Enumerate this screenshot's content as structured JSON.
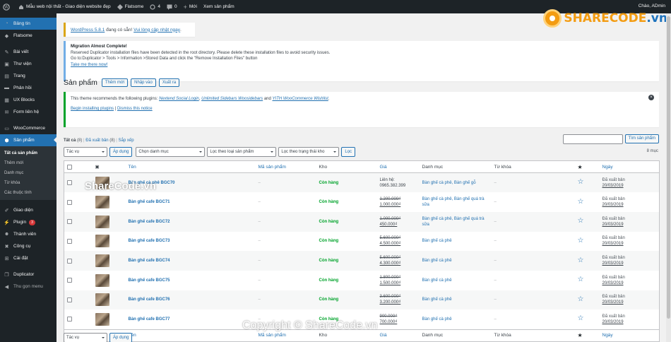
{
  "adminbar": {
    "site_name": "Mẫu web nội thất - Giao diện website đẹp",
    "theme": "Flatsome",
    "updates": "4",
    "comments": "0",
    "new_label": "Mới",
    "view_label": "Xem sản phẩm",
    "greeting": "Chào, ADmin"
  },
  "sidebar": {
    "items": [
      {
        "icon": "dashboard-icon",
        "label": "Bảng tin"
      },
      {
        "icon": "flatsome-icon",
        "label": "Flatsome"
      },
      {
        "icon": "pin-icon",
        "label": "Bài viết"
      },
      {
        "icon": "media-icon",
        "label": "Thư viện"
      },
      {
        "icon": "page-icon",
        "label": "Trang"
      },
      {
        "icon": "comment-icon",
        "label": "Phản hồi"
      },
      {
        "icon": "blocks-icon",
        "label": "UX Blocks"
      },
      {
        "icon": "form-icon",
        "label": "Form liên hệ"
      },
      {
        "icon": "woo-icon",
        "label": "WooCommerce"
      },
      {
        "icon": "product-icon",
        "label": "Sản phẩm"
      },
      {
        "icon": "brush-icon",
        "label": "Giao diện"
      },
      {
        "icon": "plugin-icon",
        "label": "Plugin",
        "badge": "3"
      },
      {
        "icon": "user-icon",
        "label": "Thành viên"
      },
      {
        "icon": "tool-icon",
        "label": "Công cụ"
      },
      {
        "icon": "settings-icon",
        "label": "Cài đặt"
      },
      {
        "icon": "duplicator-icon",
        "label": "Duplicator"
      },
      {
        "icon": "collapse-icon",
        "label": "Thu gọn menu"
      }
    ],
    "submenu": [
      "Tất cả sản phẩm",
      "Thêm mới",
      "Danh mục",
      "Từ khóa",
      "Các thuộc tính"
    ]
  },
  "notices": {
    "update_link": "WordPress 5.8.1",
    "update_text": " đang có sẵn! ",
    "update_action": "Vui lòng cập nhật ngay",
    "update_end": ".",
    "migration_title": "Migration Almost Complete!",
    "migration_line1": "Reserved Duplicator installation files have been detected in the root directory. Please delete these installation files to avoid security issues.",
    "migration_line2": "Go to:Duplicator > Tools > Information >Stored Data and click the \"Remove Installation Files\" button",
    "migration_link": "Take me there now!",
    "plugin_text1": "This theme recommends the following plugins: ",
    "plugin_a": "Nextend Social Login",
    "plugin_sep1": ", ",
    "plugin_b": "Unlimited Sidebars Woosidebars",
    "plugin_sep2": " and ",
    "plugin_c": "YITH WooCommerce Wishlist",
    "plugin_end": ".",
    "begin_link": "Begin installing plugins",
    "dismiss_link": "Dismiss this notice"
  },
  "page": {
    "title": "Sản phẩm",
    "add_new": "Thêm mới",
    "import": "Nhập vào",
    "export": "Xuất ra"
  },
  "views": {
    "all": "Tất cả",
    "all_count": "(8)",
    "published": "Đã xuất bản",
    "published_count": "(8)",
    "sort": "Sắp xếp"
  },
  "search": {
    "button": "Tìm sản phẩm"
  },
  "filters": {
    "bulk": "Tác vụ",
    "apply": "Áp dụng",
    "category": "Chọn danh mục",
    "type": "Lọc theo loại sản phẩm",
    "stock": "Lọc theo trạng thái kho",
    "filter": "Lọc",
    "count": "8 mục"
  },
  "table": {
    "headers": {
      "name": "Tên",
      "sku": "Mã sản phẩm",
      "stock": "Kho",
      "price": "Giá",
      "categories": "Danh mục",
      "tags": "Từ khóa",
      "date": "Ngày"
    },
    "rows": [
      {
        "name": "Bàn ghế cà phê BGC70",
        "sku": "–",
        "stock": "Còn hàng",
        "price_old": "Liên hệ:",
        "price_new": "0965.382.399",
        "price_contact": true,
        "categories": "Bàn ghế cà phê, Bàn ghế gỗ",
        "tags": "–",
        "status": "Đã xuất bản",
        "date": "20/03/2019"
      },
      {
        "name": "Bàn ghế cafe BGC71",
        "sku": "–",
        "stock": "Còn hàng",
        "price_old": "1.200.000₫",
        "price_new": "1.000.000₫",
        "categories": "Bàn ghế cà phê, Bàn ghế quá trà sữa",
        "tags": "–",
        "status": "Đã xuất bản",
        "date": "20/03/2019"
      },
      {
        "name": "Bàn ghế cafe BGC72",
        "sku": "–",
        "stock": "Còn hàng",
        "price_old": "1.000.000₫",
        "price_new": "450.000₫",
        "categories": "Bàn ghế cà phê, Bàn ghế quá trà sữa",
        "tags": "–",
        "status": "Đã xuất bản",
        "date": "20/03/2019"
      },
      {
        "name": "Bàn ghế cafe BGC73",
        "sku": "–",
        "stock": "Còn hàng",
        "price_old": "5.600.000₫",
        "price_new": "4.500.000₫",
        "categories": "Bàn ghế cà phê",
        "tags": "–",
        "status": "Đã xuất bản",
        "date": "20/03/2019"
      },
      {
        "name": "Bàn ghế cafe BGC74",
        "sku": "–",
        "stock": "Còn hàng",
        "price_old": "5.600.000₫",
        "price_new": "4.300.000₫",
        "categories": "Bàn ghế cà phê",
        "tags": "–",
        "status": "Đã xuất bản",
        "date": "20/03/2019"
      },
      {
        "name": "Bàn ghế cafe BGC75",
        "sku": "–",
        "stock": "Còn hàng",
        "price_old": "1.800.000₫",
        "price_new": "1.500.000₫",
        "categories": "Bàn ghế cà phê",
        "tags": "–",
        "status": "Đã xuất bản",
        "date": "20/03/2019"
      },
      {
        "name": "Bàn ghế cafe BGC76",
        "sku": "–",
        "stock": "Còn hàng",
        "price_old": "3.600.000₫",
        "price_new": "3.200.000₫",
        "categories": "Bàn ghế cà phê",
        "tags": "–",
        "status": "Đã xuất bản",
        "date": "20/03/2019"
      },
      {
        "name": "Bàn ghế cafe BGC77",
        "sku": "–",
        "stock": "Còn hàng",
        "price_old": "900.000₫",
        "price_new": "700.000₫",
        "categories": "Bàn ghế cà phê",
        "tags": "–",
        "status": "Đã xuất bản",
        "date": "20/03/2019"
      }
    ]
  },
  "watermarks": {
    "center": "ShareCode.vn",
    "bottom": "Copyright © ShareCode.vn",
    "logo_a": "SHARECODE",
    "logo_b": ".vn"
  },
  "colors": {
    "accent": "#2271b1",
    "instock": "#00a32a",
    "sidebar": "#1d2327"
  }
}
